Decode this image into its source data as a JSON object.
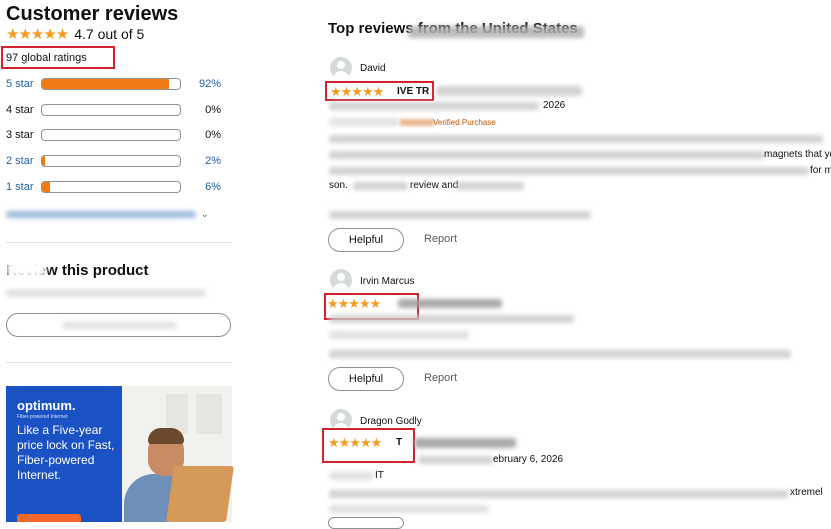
{
  "summary": {
    "title": "Customer reviews",
    "rating_stars": "★★★★★",
    "rating_text": "4.7 out of 5",
    "global_ratings": "97 global ratings",
    "histogram": [
      {
        "label": "5 star",
        "percent": "92%",
        "value": 92
      },
      {
        "label": "4 star",
        "percent": "0%",
        "value": 0
      },
      {
        "label": "3 star",
        "percent": "0%",
        "value": 0
      },
      {
        "label": "2 star",
        "percent": "2%",
        "value": 2
      },
      {
        "label": "1 star",
        "percent": "6%",
        "value": 6
      }
    ]
  },
  "review_product": {
    "heading": "Review this product"
  },
  "ad": {
    "brand": "optimum.",
    "brand_sub": "Fiber-powered Internet",
    "text": "Like a Five-year price lock on Fast, Fiber-powered Internet."
  },
  "reviews_section": {
    "heading": "Top reviews from the United States"
  },
  "reviews": [
    {
      "name": "David",
      "stars": "★★★★★",
      "title_fragment": "IVE TR",
      "date_fragment": "2026",
      "verified": "Verified Purchase",
      "body_fragment_1": "magnets that you",
      "body_fragment_2": "for my",
      "body_fragment_3": "son.",
      "body_fragment_4": "review and",
      "helpful": "Helpful",
      "report": "Report"
    },
    {
      "name": "Irvin Marcus",
      "stars": "★★★★★",
      "helpful": "Helpful",
      "report": "Report"
    },
    {
      "name": "Dragon Godly",
      "stars": "★★★★★",
      "title_fragment": "T",
      "date_fragment": "ebruary 6, 2026",
      "body_fragment_1": "IT",
      "body_fragment_2": "xtremel"
    }
  ]
}
